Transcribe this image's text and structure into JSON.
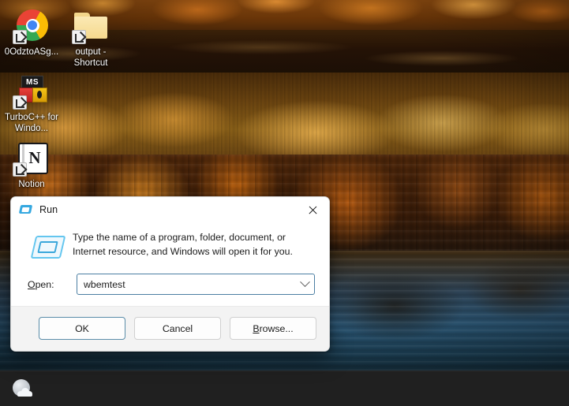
{
  "desktop": {
    "icons": [
      {
        "label": "0OdztoASg...",
        "icon": "chrome-icon",
        "shortcut": true
      },
      {
        "label": "output - Shortcut",
        "icon": "folder-icon",
        "shortcut": true
      },
      {
        "label": "TurboC++ for Windo...",
        "icon": "msdos-icon",
        "shortcut": true
      },
      {
        "label": "Notion",
        "icon": "notion-icon",
        "shortcut": true
      }
    ]
  },
  "taskbar": {
    "weather_icon": "sun-cloud-icon",
    "background_color": "#202020"
  },
  "run_dialog": {
    "title": "Run",
    "title_icon": "run-window-icon",
    "close_icon": "close-icon",
    "main_icon": "run-window-icon",
    "description": "Type the name of a program, folder, document, or Internet resource, and Windows will open it for you.",
    "open_label_prefix": "",
    "open_label_accel": "O",
    "open_label_suffix": "pen:",
    "open_value": "wbemtest",
    "open_placeholder": "",
    "dropdown_icon": "chevron-down-icon",
    "buttons": {
      "ok": "OK",
      "cancel": "Cancel",
      "browse_accel": "B",
      "browse_suffix": "rowse..."
    },
    "accent_color": "#5b8da9",
    "field_border_color": "#4c7fa3"
  }
}
